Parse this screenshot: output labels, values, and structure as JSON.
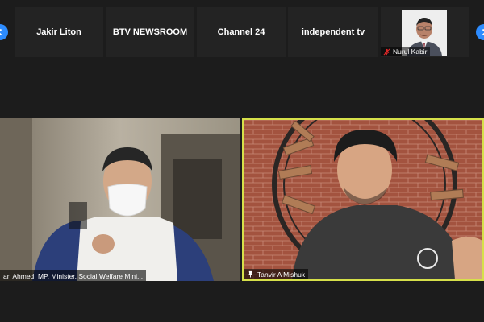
{
  "thumbnail_strip": {
    "tiles": [
      {
        "name": "Jakir Liton",
        "muted": false
      },
      {
        "name": "BTV NEWSROOM",
        "muted": true
      },
      {
        "name": "Channel 24",
        "muted": true
      },
      {
        "name": "independent tv",
        "muted": true
      }
    ],
    "video_tile": {
      "name": "Nurul Kabir",
      "muted": true
    }
  },
  "main_videos": {
    "left": {
      "name": "an Ahmed, MP,  Minister,  Social Welfare Mini..."
    },
    "right": {
      "name": "Tanvir A Mishuk",
      "active_speaker": true,
      "active_border_color": "#d6e04a"
    }
  },
  "colors": {
    "background": "#1c1c1c",
    "tile": "#232323",
    "nav_arrow": "#2d8cff",
    "mute_icon": "#e02828"
  },
  "icons": [
    "chevron-left-icon",
    "chevron-right-icon",
    "muted-microphone-icon",
    "pin-icon"
  ]
}
